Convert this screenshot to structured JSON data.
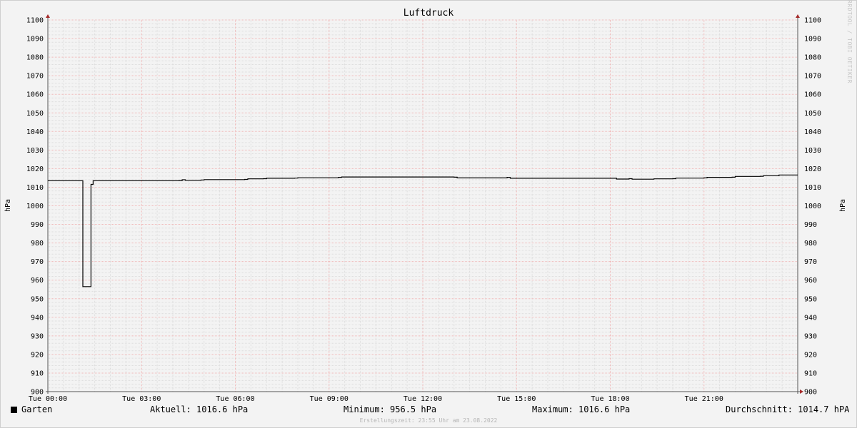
{
  "chart_data": {
    "type": "line",
    "title": "Luftdruck",
    "ylabel_left": "hPa",
    "ylabel_right": "hPa",
    "ylim": [
      900,
      1100
    ],
    "y_ticks": [
      900,
      910,
      920,
      930,
      940,
      950,
      960,
      970,
      980,
      990,
      1000,
      1010,
      1020,
      1030,
      1040,
      1050,
      1060,
      1070,
      1080,
      1090,
      1100
    ],
    "x_range_hours": [
      0,
      24
    ],
    "x_ticks": [
      {
        "h": 0,
        "label": "Tue 00:00"
      },
      {
        "h": 3,
        "label": "Tue 03:00"
      },
      {
        "h": 6,
        "label": "Tue 06:00"
      },
      {
        "h": 9,
        "label": "Tue 09:00"
      },
      {
        "h": 12,
        "label": "Tue 12:00"
      },
      {
        "h": 15,
        "label": "Tue 15:00"
      },
      {
        "h": 18,
        "label": "Tue 18:00"
      },
      {
        "h": 21,
        "label": "Tue 21:00"
      }
    ],
    "grid": true,
    "legend_position": "bottom-left",
    "series": [
      {
        "name": "Garten",
        "color": "#000000",
        "points": [
          [
            0.0,
            1013.5
          ],
          [
            1.1,
            1013.5
          ],
          [
            1.12,
            956.5
          ],
          [
            1.18,
            956.5
          ],
          [
            1.38,
            1011.5
          ],
          [
            1.42,
            1011.5
          ],
          [
            1.45,
            1013.5
          ],
          [
            2.5,
            1013.5
          ],
          [
            4.2,
            1013.6
          ],
          [
            4.3,
            1014.0
          ],
          [
            4.4,
            1013.7
          ],
          [
            4.9,
            1013.9
          ],
          [
            5.0,
            1014.1
          ],
          [
            6.3,
            1014.2
          ],
          [
            6.4,
            1014.5
          ],
          [
            6.9,
            1014.6
          ],
          [
            7.0,
            1014.8
          ],
          [
            7.9,
            1014.9
          ],
          [
            8.0,
            1015.1
          ],
          [
            9.3,
            1015.3
          ],
          [
            9.4,
            1015.5
          ],
          [
            12.0,
            1015.5
          ],
          [
            13.0,
            1015.4
          ],
          [
            13.1,
            1015.0
          ],
          [
            14.5,
            1015.0
          ],
          [
            14.7,
            1015.3
          ],
          [
            14.8,
            1014.8
          ],
          [
            18.1,
            1014.8
          ],
          [
            18.2,
            1014.4
          ],
          [
            18.5,
            1014.4
          ],
          [
            18.6,
            1014.6
          ],
          [
            18.7,
            1014.3
          ],
          [
            19.3,
            1014.3
          ],
          [
            19.4,
            1014.5
          ],
          [
            20.0,
            1014.6
          ],
          [
            20.1,
            1014.9
          ],
          [
            21.0,
            1015.0
          ],
          [
            21.1,
            1015.3
          ],
          [
            21.9,
            1015.4
          ],
          [
            22.0,
            1015.8
          ],
          [
            22.8,
            1015.9
          ],
          [
            22.9,
            1016.2
          ],
          [
            23.3,
            1016.2
          ],
          [
            23.4,
            1016.6
          ],
          [
            24.0,
            1016.6
          ]
        ]
      }
    ]
  },
  "credit": "RRDTOOL / TOBI OETIKER",
  "legend": {
    "series_name": "Garten",
    "aktuell": "Aktuell: 1016.6 hPa",
    "minimum": "Minimum: 956.5 hPa",
    "maximum": "Maximum: 1016.6 hPa",
    "durchschnitt": "Durchschnitt: 1014.7 hPA"
  },
  "footer": "Erstellungszeit: 23:55 Uhr am 23.08.2022"
}
